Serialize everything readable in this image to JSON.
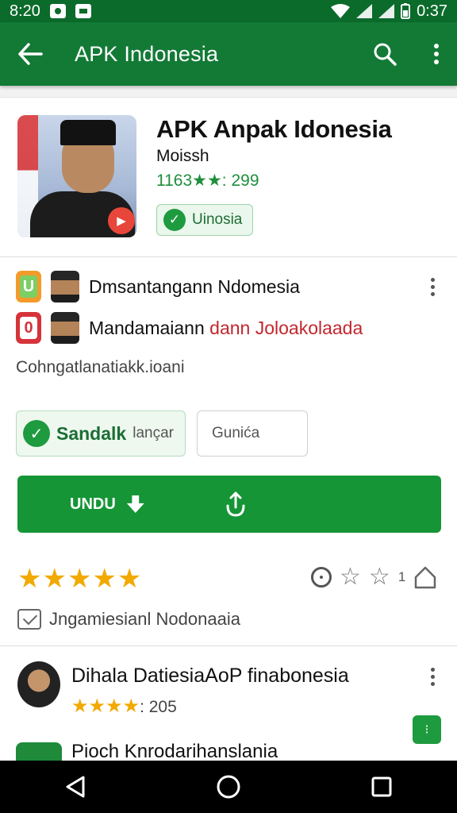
{
  "status_bar": {
    "time_left": "8:20",
    "time_right": "0:37"
  },
  "app_bar": {
    "title": "APK Indonesia"
  },
  "app": {
    "name": "APK Anpak Idonesia",
    "developer": "Moissh",
    "rating_text": "1163★★: 299",
    "pill_label": "Uinosia"
  },
  "list": [
    {
      "label": "Dmsantangann Ndomesia",
      "label_red": ""
    },
    {
      "label": "Mandamaiann ",
      "label_red": "dann Joloakolaada"
    }
  ],
  "caption": "Cohngatlanatiakk.ioani",
  "tags": {
    "installed_main": "Sandalk",
    "installed_sub": "lançar",
    "secondary": "Gunića"
  },
  "download": {
    "label": "UNDU"
  },
  "rating_row": {
    "stars": "★★★★★",
    "count": "1"
  },
  "meta_text": "Jngamiesianl Nodonaaia",
  "reviews": [
    {
      "name": "Dihala DatiesiaAoP finabonesia",
      "stars": "★★★★",
      "count": ": 205"
    },
    {
      "name": "Pioch Knrodarihanslania"
    }
  ],
  "colors": {
    "primary": "#137a36",
    "accent": "#159536",
    "star": "#f2a900",
    "danger": "#c3262d"
  }
}
